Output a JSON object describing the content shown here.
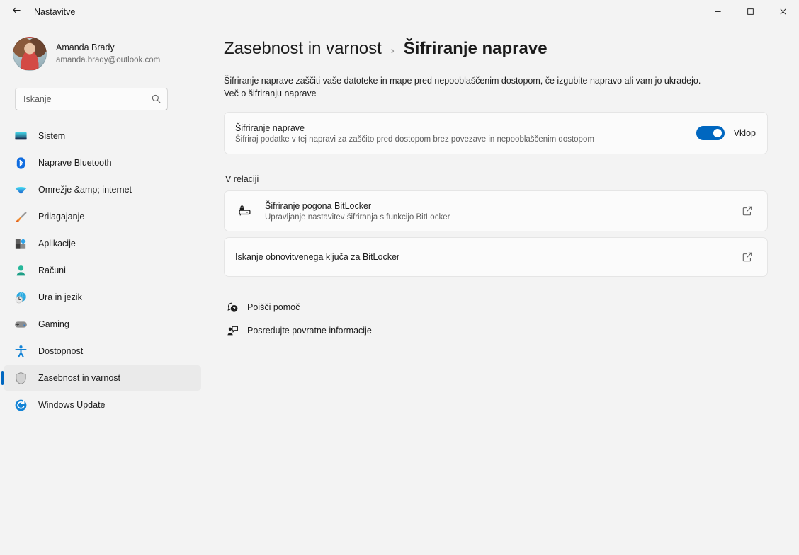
{
  "titlebar": {
    "app_title": "Nastavitve",
    "back_icon": "back-arrow-icon",
    "minimize_label": "—",
    "maximize_label": "□",
    "close_label": "✕"
  },
  "sidebar": {
    "account": {
      "name": "Amanda Brady",
      "email": "amanda.brady@outlook.com"
    },
    "search": {
      "placeholder": "Iskanje",
      "value": "",
      "icon": "search-icon"
    },
    "items": [
      {
        "label": "Sistem",
        "icon": "monitor-icon",
        "selected": false
      },
      {
        "label": "Naprave Bluetooth",
        "icon": "bluetooth-icon",
        "selected": false
      },
      {
        "label": "Omrežje &amp; internet",
        "icon": "wifi-icon",
        "selected": false
      },
      {
        "label": "Prilagajanje",
        "icon": "paintbrush-icon",
        "selected": false
      },
      {
        "label": "Aplikacije",
        "icon": "apps-icon",
        "selected": false
      },
      {
        "label": "Računi",
        "icon": "person-icon",
        "selected": false
      },
      {
        "label": "Ura in jezik",
        "icon": "clock-globe-icon",
        "selected": false
      },
      {
        "label": "Gaming",
        "icon": "gamepad-icon",
        "selected": false
      },
      {
        "label": "Dostopnost",
        "icon": "accessibility-icon",
        "selected": false
      },
      {
        "label": "Zasebnost in varnost",
        "icon": "shield-icon",
        "selected": true
      },
      {
        "label": "Windows Update",
        "icon": "update-icon",
        "selected": false
      }
    ]
  },
  "main": {
    "breadcrumb": {
      "parent": "Zasebnost in varnost",
      "separator": "›",
      "current": "Šifriranje naprave"
    },
    "description": "Šifriranje naprave zaščiti vaše datoteke in mape pred nepooblas̆čenim dostopom, če izgubite napravo ali vam jo ukradejo.",
    "learn_more": "Več o šifriranju naprave",
    "encryption_toggle": {
      "title": "Šifriranje naprave",
      "subtitle": "Šifriraj podatke v tej napravi za zaščito pred dostopom brez povezave in nepooblas̆čenim dostopom",
      "state_label": "Vklop",
      "on": true,
      "accent_color": "#0067C0"
    },
    "related_heading": "V relaciji",
    "related_items": [
      {
        "title": "Šifriranje pogona BitLocker",
        "subtitle": "Upravljanje nastavitev šifriranja s funkcijo BitLocker",
        "icon": "bitlocker-drive-icon",
        "action_icon": "open-external-icon"
      },
      {
        "title": "Iskanje obnovitvenega ključa za BitLocker",
        "subtitle": "",
        "icon": "",
        "action_icon": "open-external-icon"
      }
    ],
    "footer_links": [
      {
        "label": "Poišči pomoč",
        "icon": "help-icon"
      },
      {
        "label": "Posredujte povratne informacije",
        "icon": "feedback-icon"
      }
    ]
  }
}
